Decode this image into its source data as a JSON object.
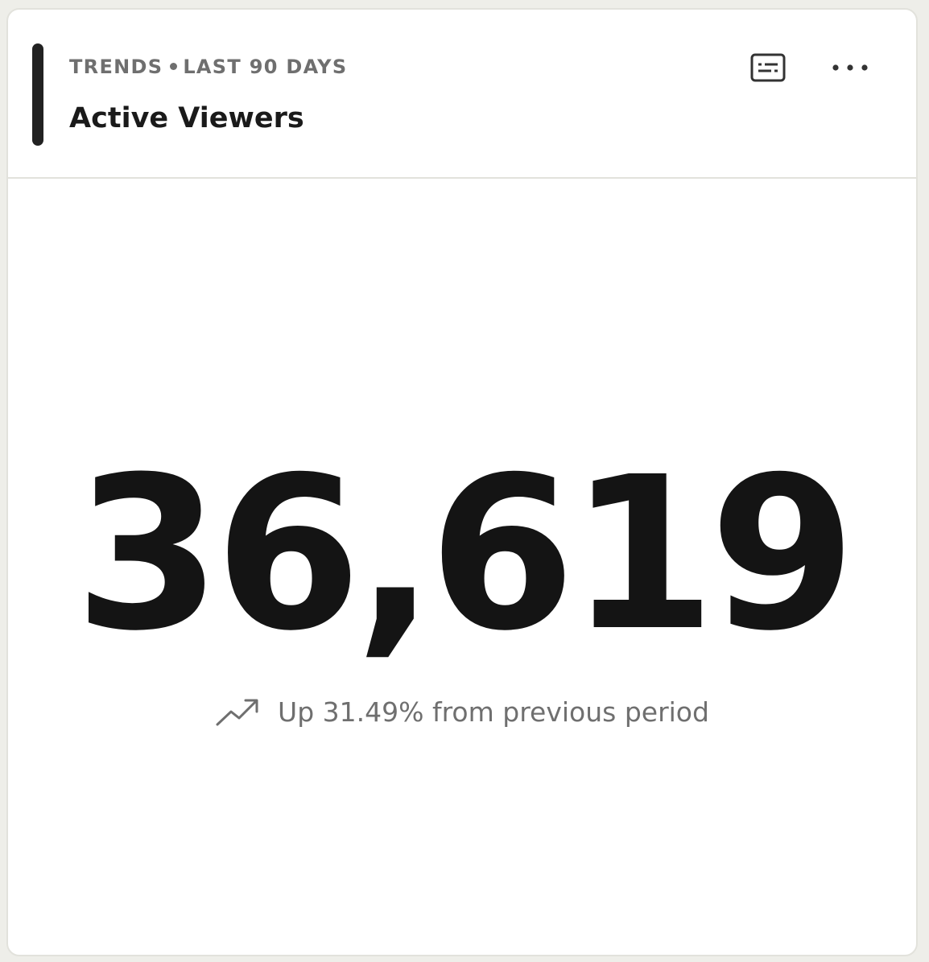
{
  "header": {
    "eyebrow_type": "TRENDS",
    "eyebrow_range": "LAST 90 DAYS",
    "title": "Active Viewers",
    "icons": [
      "caption-icon",
      "more-horizontal-icon"
    ]
  },
  "metric": {
    "value": "36,619"
  },
  "trend": {
    "direction": "up",
    "icon": "trending-up-icon",
    "text": "Up 31.49% from previous period"
  },
  "colors": {
    "accent_bar": "#222222",
    "muted_text": "#6f6f6f",
    "metric_text": "#141414",
    "border": "#e2e2dc"
  }
}
